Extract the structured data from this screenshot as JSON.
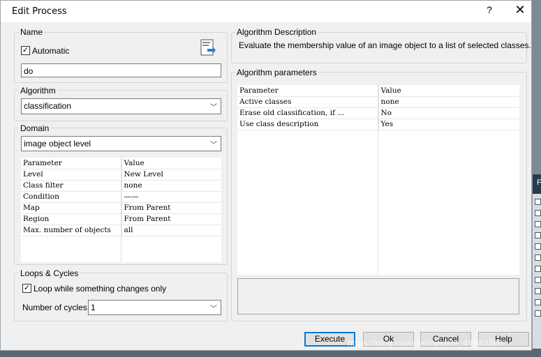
{
  "window": {
    "title": "Edit Process",
    "help_glyph": "?",
    "close_glyph": "✕"
  },
  "name_group": {
    "label": "Name",
    "automatic_label": "Automatic",
    "automatic_checked": true,
    "value": "do",
    "icon": "document-edit-icon"
  },
  "algorithm_group": {
    "label": "Algorithm",
    "selected": "classification"
  },
  "domain_group": {
    "label": "Domain",
    "selected": "image object level",
    "headers": [
      "Parameter",
      "Value"
    ],
    "rows": [
      {
        "param": "Level",
        "value": "New Level"
      },
      {
        "param": "Class filter",
        "value": "none"
      },
      {
        "param": "Condition",
        "value": "——"
      },
      {
        "param": "Map",
        "value": "From Parent"
      },
      {
        "param": "Region",
        "value": "From Parent"
      },
      {
        "param": "Max. number of objects",
        "value": "all"
      }
    ]
  },
  "loops_group": {
    "label": "Loops & Cycles",
    "loop_label": "Loop while something changes only",
    "loop_checked": true,
    "cycles_label": "Number of cycles",
    "cycles_value": "1"
  },
  "description_group": {
    "label": "Algorithm Description",
    "text": "Evaluate the membership value of an image object to a list of selected classes."
  },
  "parameters_group": {
    "label": "Algorithm parameters",
    "headers": [
      "Parameter",
      "Value"
    ],
    "rows": [
      {
        "param": "Active classes",
        "value": "none"
      },
      {
        "param": "Erase old classification, if ...",
        "value": "No"
      },
      {
        "param": "Use class description",
        "value": "Yes"
      }
    ]
  },
  "buttons": {
    "execute": "Execute",
    "ok": "Ok",
    "cancel": "Cancel",
    "help": "Help"
  },
  "watermark": "https://blog.csdn.net/weixin_44683380",
  "background_window": {
    "header_char": "F"
  }
}
